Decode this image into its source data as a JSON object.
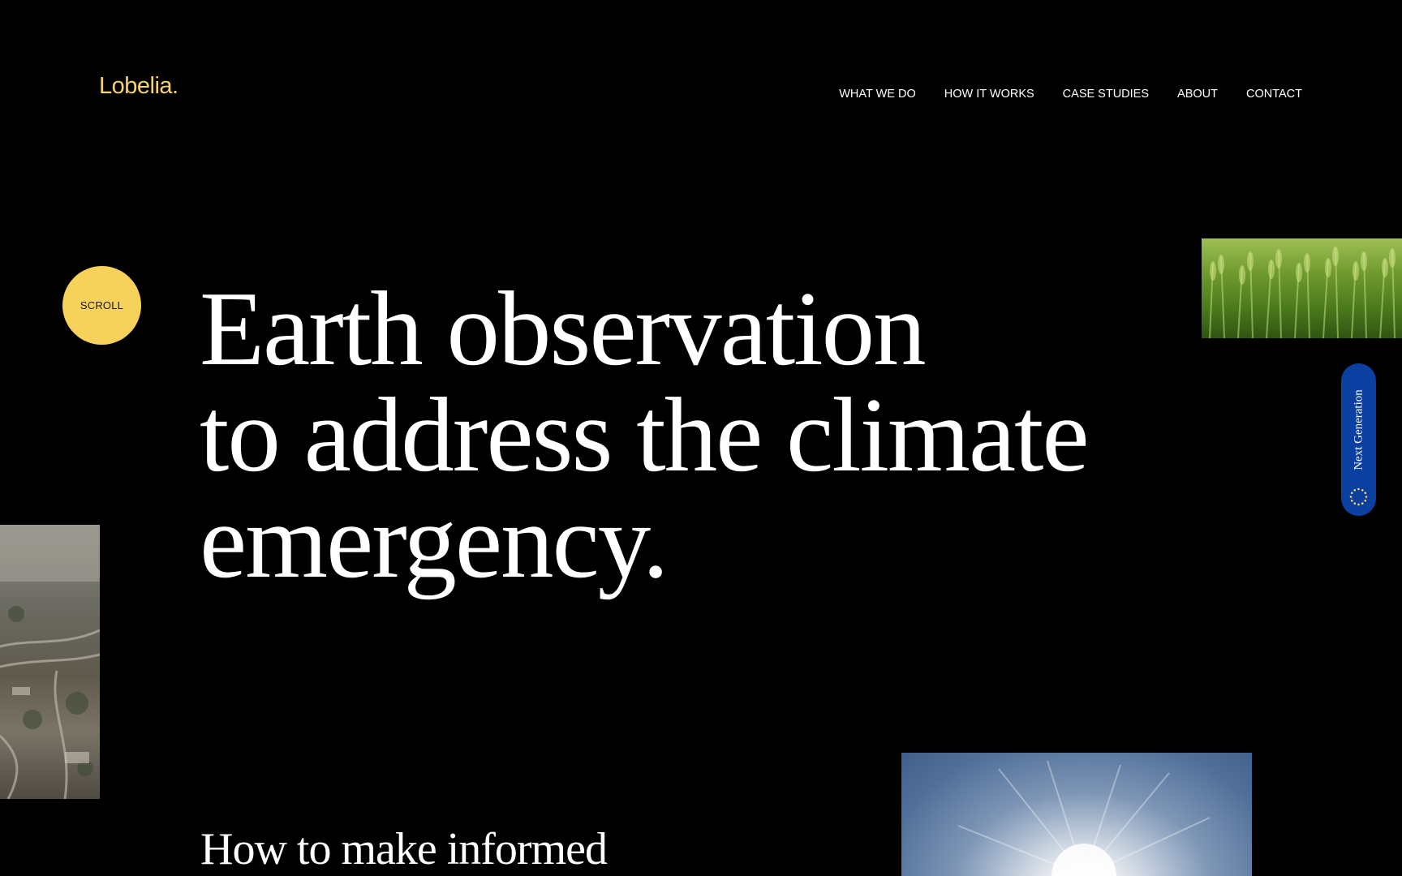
{
  "brand": {
    "logo_text": "Lobelia.",
    "accent_color": "#f7d25a"
  },
  "nav": {
    "items": [
      {
        "label": "WHAT WE DO"
      },
      {
        "label": "HOW IT WORKS"
      },
      {
        "label": "CASE STUDIES"
      },
      {
        "label": "ABOUT"
      },
      {
        "label": "CONTACT"
      }
    ]
  },
  "scroll_button": {
    "label": "SCROLL"
  },
  "hero": {
    "lines": [
      "Earth observation",
      "to address the climate",
      "emergency."
    ]
  },
  "section": {
    "subheading": "How to make informed"
  },
  "side_badge": {
    "label": "Next Generation",
    "icon": "eu-stars-icon",
    "color": "#0b3fa0"
  },
  "images": {
    "top_right": "wheat-field-image",
    "left": "aerial-city-image",
    "bottom": "sun-sky-image"
  }
}
